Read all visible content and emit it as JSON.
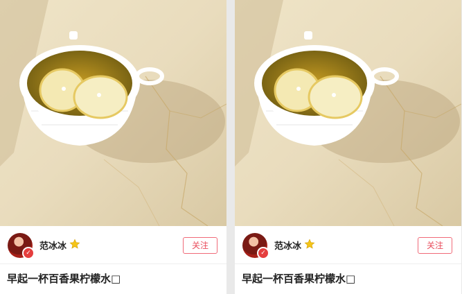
{
  "cards": [
    {
      "author": {
        "name": "范冰冰",
        "verified_mark": "✓"
      },
      "follow_label": "关注",
      "title": "早起一杯百香果柠檬水□",
      "image": {
        "subject": "lemon-passionfruit-tea-cup"
      }
    },
    {
      "author": {
        "name": "范冰冰",
        "verified_mark": "✓"
      },
      "follow_label": "关注",
      "title": "早起一杯百香果柠檬水□",
      "image": {
        "subject": "lemon-passionfruit-tea-cup"
      }
    }
  ],
  "colors": {
    "accent": "#e94c5c",
    "text": "#222222",
    "background": "#e9e9e9",
    "star": "#f5c518"
  },
  "icons": [
    "star-icon",
    "verified-icon"
  ]
}
